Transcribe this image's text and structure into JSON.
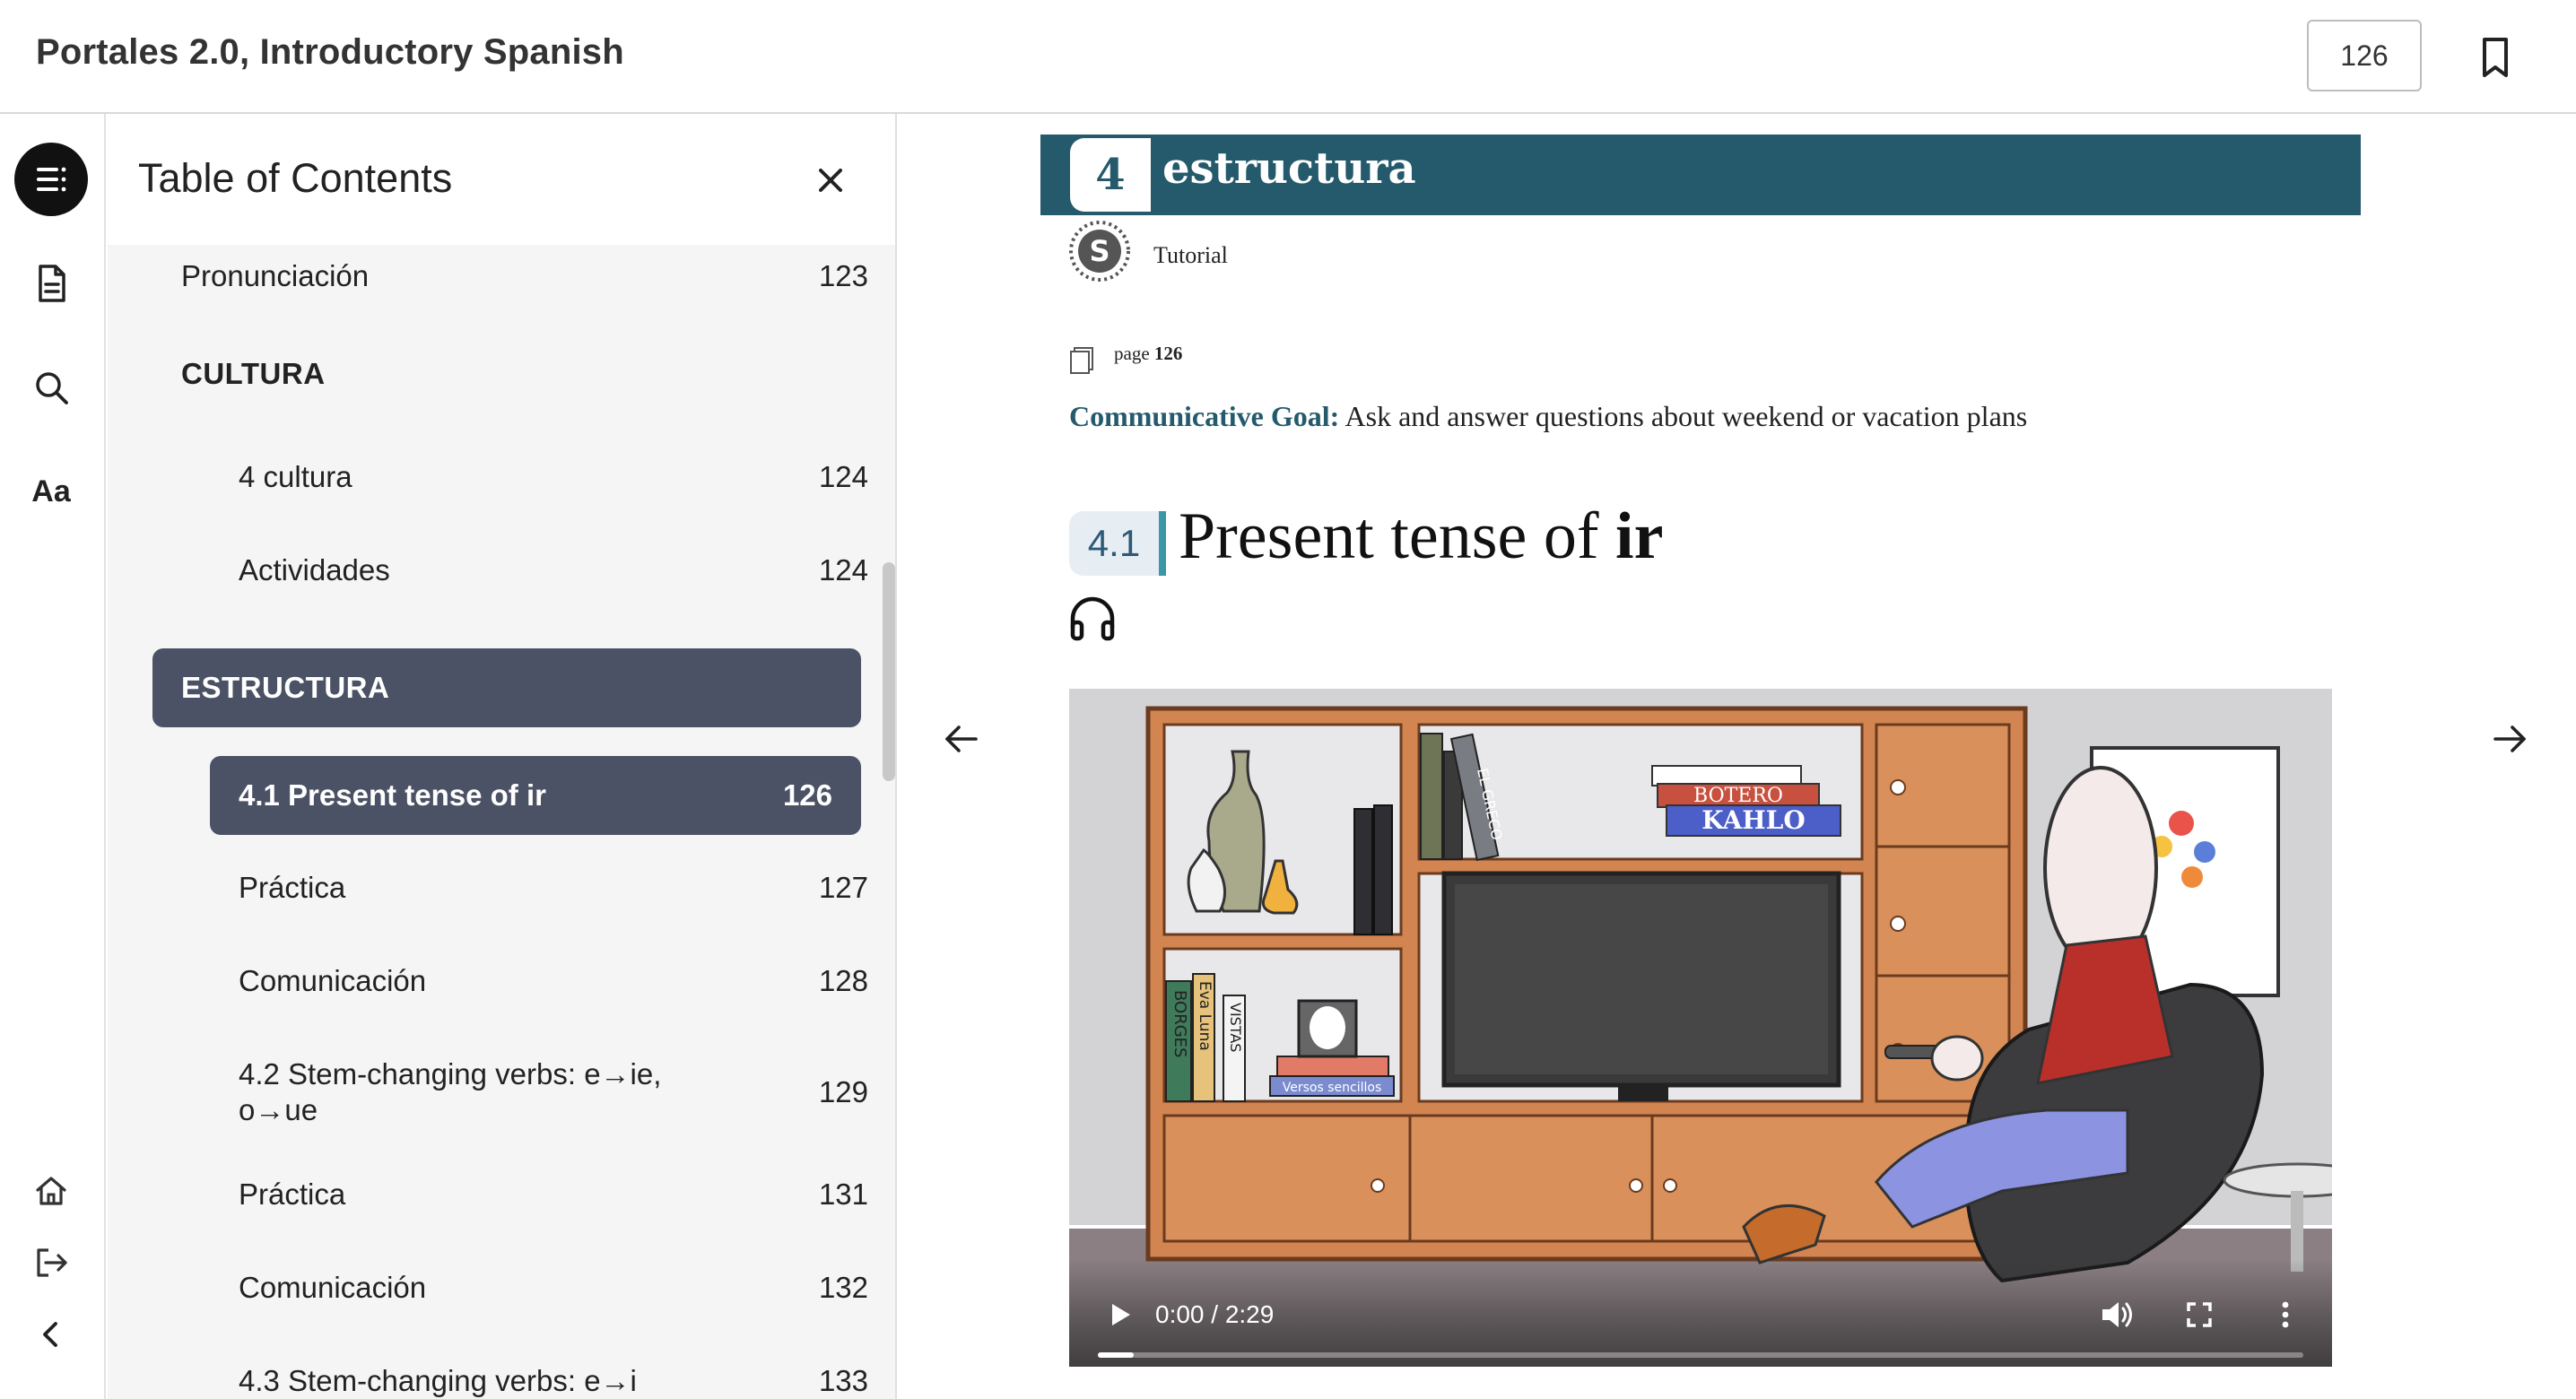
{
  "header": {
    "title": "Portales 2.0, Introductory Spanish",
    "page_value": "126"
  },
  "rail": {
    "font_label": "Aa"
  },
  "toc": {
    "title": "Table of Contents",
    "items": [
      {
        "label": "Pronunciación",
        "page": "123"
      },
      {
        "label": "CULTURA",
        "page": ""
      },
      {
        "label": "4 cultura",
        "page": "124"
      },
      {
        "label": "Actividades",
        "page": "124"
      },
      {
        "label": "ESTRUCTURA",
        "page": ""
      },
      {
        "label": "4.1 Present tense of ir",
        "page": "126"
      },
      {
        "label": "Práctica",
        "page": "127"
      },
      {
        "label": "Comunicación",
        "page": "128"
      },
      {
        "label": "4.2 Stem-changing verbs: e→ie,",
        "label2": "o→ue",
        "page": "129"
      },
      {
        "label": "Práctica",
        "page": "131"
      },
      {
        "label": "Comunicación",
        "page": "132"
      },
      {
        "label": "4.3 Stem-changing verbs: e→i",
        "page": "133"
      }
    ]
  },
  "reader": {
    "banner_number": "4",
    "banner_label": "estructura",
    "tutorial_label": "Tutorial",
    "page_ref_prefix": "page",
    "page_ref_number": "126",
    "goal_label": "Communicative Goal:",
    "goal_text": " Ask and answer questions about weekend or vacation plans",
    "section_number": "4.1",
    "section_title_prefix": "Present tense of ",
    "section_title_word": "ir",
    "video": {
      "time": "0:00 / 2:29",
      "progress": 0.03,
      "books": {
        "spine1": "EL GRECO",
        "top_book": "BOTERO",
        "bottom_book": "KAHLO",
        "left1": "BORGES",
        "left2": "Eva Luna",
        "left3": "VISTAS",
        "small_book": "Versos sencillos"
      }
    }
  }
}
